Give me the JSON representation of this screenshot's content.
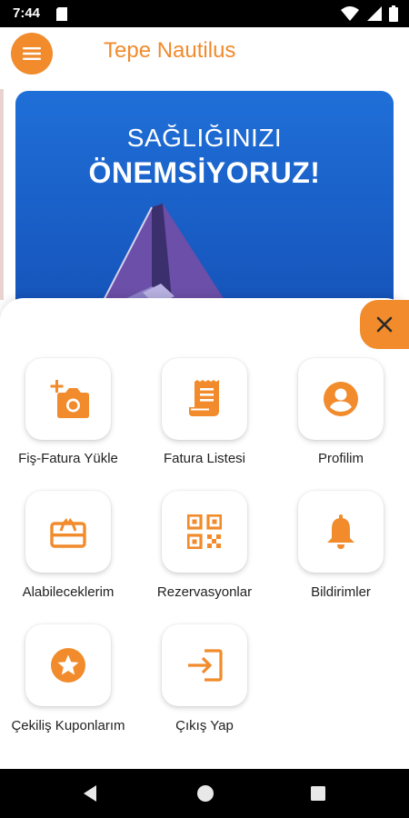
{
  "status_bar": {
    "time": "7:44"
  },
  "app_bar": {
    "title": "Tepe Nautilus",
    "menu_icon": "hamburger-icon"
  },
  "banner": {
    "line1": "SAĞLIĞINIZI",
    "line2": "ÖNEMSİYORUZ!"
  },
  "menu_items": [
    {
      "label": "Fiş-Fatura Yükle",
      "icon": "add-photo-icon"
    },
    {
      "label": "Fatura Listesi",
      "icon": "receipt-icon"
    },
    {
      "label": "Profilim",
      "icon": "account-circle-icon"
    },
    {
      "label": "Alabileceklerim",
      "icon": "gift-card-icon"
    },
    {
      "label": "Rezervasyonlar",
      "icon": "qr-code-icon"
    },
    {
      "label": "Bildirimler",
      "icon": "bell-icon"
    },
    {
      "label": "Çekiliş Kuponlarım",
      "icon": "star-icon"
    },
    {
      "label": "Çıkış Yap",
      "icon": "logout-icon"
    }
  ],
  "colors": {
    "accent": "#f18b2c",
    "banner_blue": "#1a5fca"
  }
}
